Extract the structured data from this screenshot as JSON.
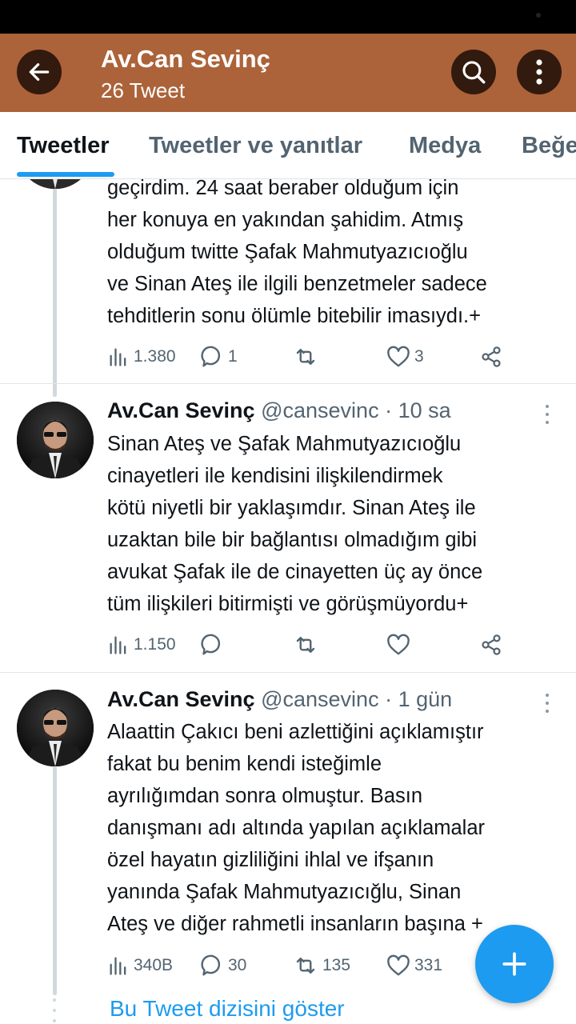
{
  "header": {
    "title": "Av.Can Sevinç",
    "subtitle": "26 Tweet",
    "back_icon": "arrow-left-icon",
    "search_icon": "search-icon",
    "more_icon": "more-vertical-icon",
    "bg_color": "#ac6339"
  },
  "tabs": [
    {
      "label": "Tweetler",
      "active": true
    },
    {
      "label": "Tweetler ve yanıtlar",
      "active": false
    },
    {
      "label": "Medya",
      "active": false
    },
    {
      "label": "Beğe",
      "active": false
    }
  ],
  "tweets": [
    {
      "partial": true,
      "lines": [
        "geçirdim. 24 saat beraber olduğum için",
        "her konuya en yakından şahidim. Atmış",
        "olduğum twitte Şafak Mahmutyazıcıoğlu",
        "ve Sinan Ateş ile ilgili benzetmeler sadece",
        "tehditlerin sonu ölümle bitebilir imasıydı.+"
      ],
      "views": "1.380",
      "replies": "1",
      "retweets": "",
      "likes": "3"
    },
    {
      "name": "Av.Can Sevinç",
      "handle": "@cansevinc",
      "sep": " · ",
      "time": "10 sa",
      "lines": [
        "Sinan Ateş ve Şafak Mahmutyazıcıoğlu",
        "cinayetleri ile kendisini ilişkilendirmek",
        "kötü niyetli bir yaklaşımdır. Sinan Ateş ile",
        "uzaktan bile bir bağlantısı olmadığım gibi",
        "avukat Şafak ile de cinayetten üç ay önce",
        "tüm ilişkileri bitirmişti ve görüşmüyordu+"
      ],
      "views": "1.150",
      "replies": "",
      "retweets": "",
      "likes": ""
    },
    {
      "name": "Av.Can Sevinç",
      "handle": "@cansevinc",
      "sep": " · ",
      "time": "1 gün",
      "lines": [
        "Alaattin Çakıcı beni azlettiğini açıklamıştır",
        "fakat bu benim kendi isteğimle",
        "ayrılığımdan sonra olmuştur. Basın",
        "danışmanı adı altında yapılan açıklamalar",
        "özel hayatın gizliliğini ihlal ve ifşanın",
        "yanında Şafak Mahmutyazıcığlu, Sinan",
        "Ateş ve diğer rahmetli insanların başına +"
      ],
      "views": "340B",
      "replies": "30",
      "retweets": "135",
      "likes": "331"
    }
  ],
  "show_thread": "Bu Tweet dizisini göster",
  "fab_icon": "plus-icon",
  "colors": {
    "accent": "#1d9bf0",
    "muted": "#536471",
    "text": "#0f1419"
  }
}
